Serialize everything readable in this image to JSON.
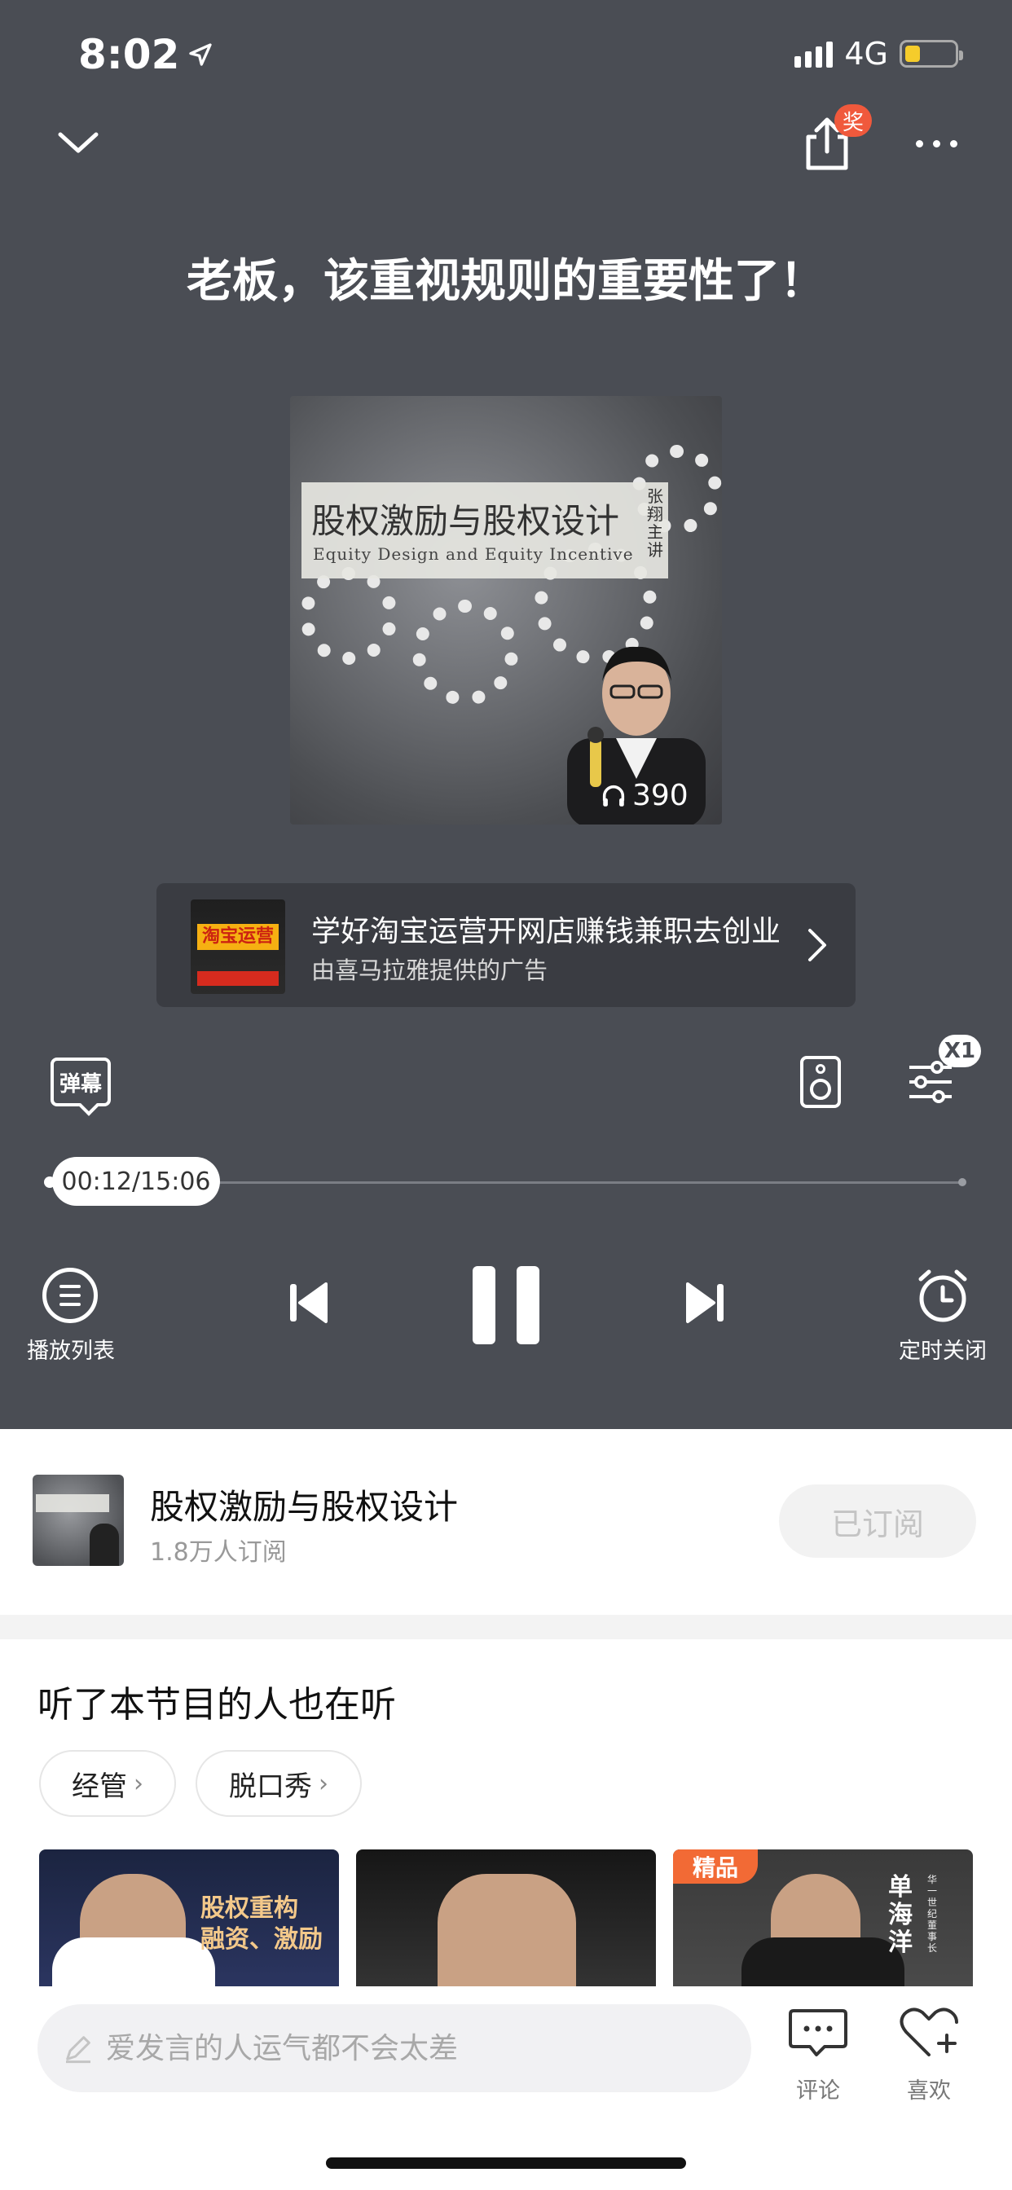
{
  "status_bar": {
    "time": "8:02",
    "network": "4G",
    "battery_level": 0.3
  },
  "header": {
    "share_badge": "奖",
    "collapse_icon": "chevron-down-icon",
    "share_icon": "share-icon",
    "more_icon": "more-icon"
  },
  "track": {
    "title": "老板，该重视规则的重要性了！"
  },
  "cover": {
    "title": "股权激励与股权设计",
    "subtitle": "Equity Design and Equity Incentive",
    "author": "张翔主讲",
    "plays": "390"
  },
  "ad": {
    "thumb_text": "淘宝运营",
    "title": "学好淘宝运营开网店赚钱兼职去创业",
    "subtitle": "由喜马拉雅提供的广告"
  },
  "tools": {
    "danmaku_label": "弹幕",
    "speed_label": "X1"
  },
  "progress": {
    "time": "00:12/15:06",
    "fraction": 0.013
  },
  "controls": {
    "playlist_label": "播放列表",
    "timer_label": "定时关闭"
  },
  "album": {
    "name": "股权激励与股权设计",
    "subscribers": "1.8万人订阅",
    "subscribe_label": "已订阅"
  },
  "recommend": {
    "title": "听了本节目的人也在听",
    "tags": [
      {
        "label": "经管"
      },
      {
        "label": "脱口秀"
      }
    ],
    "cards": [
      {
        "text": "股权重构 融资、激励"
      },
      {
        "text": ""
      },
      {
        "badge": "精品",
        "name": "单海洋",
        "subtitle": "华一世纪董事长"
      }
    ]
  },
  "bottom_bar": {
    "placeholder": "爱发言的人运气都不会太差",
    "comment_label": "评论",
    "like_label": "喜欢"
  },
  "colors": {
    "player_bg": "#4a4d54",
    "accent_orange": "#f0593c",
    "battery": "#f5cc2b"
  }
}
